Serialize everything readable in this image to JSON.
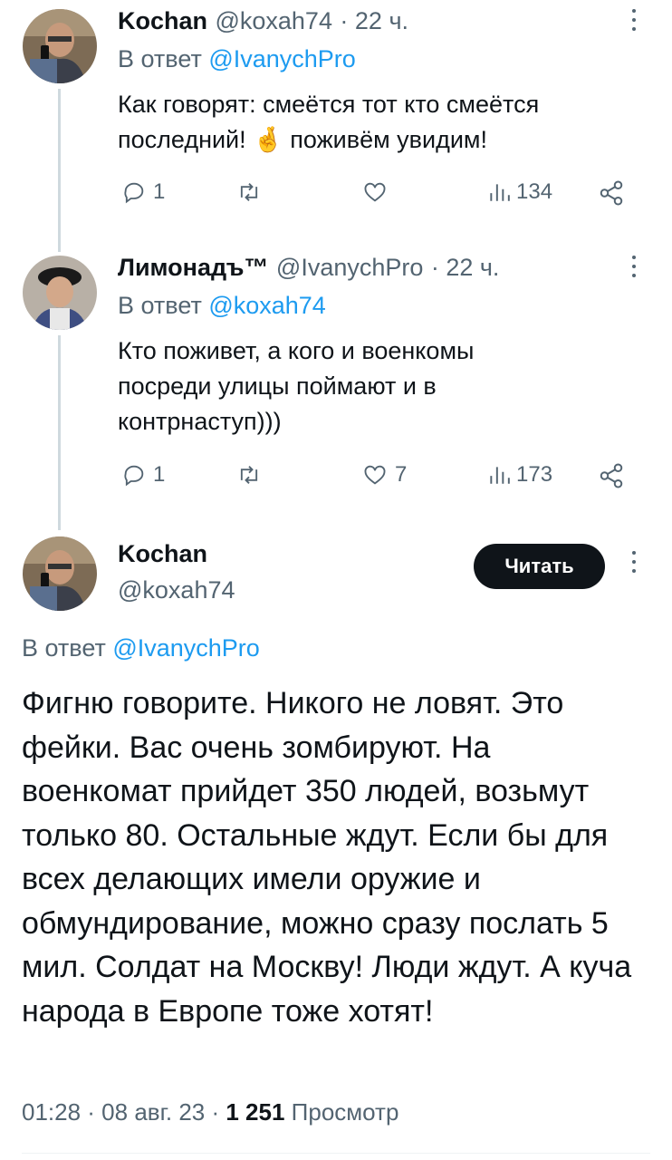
{
  "tweets": [
    {
      "name": "Kochan",
      "handle": "@koxah74",
      "time": "· 22 ч.",
      "reply_prefix": "В ответ ",
      "reply_handle": "@IvanychPro",
      "text": "Как говорят: смеётся тот кто смеётся последний! 🤞 поживём увидим!",
      "replies": "1",
      "retweets": "",
      "likes": "",
      "views": "134"
    },
    {
      "name": "Лимонадъ™",
      "handle": "@IvanychPro",
      "time": "· 22 ч.",
      "reply_prefix": "В ответ ",
      "reply_handle": "@koxah74",
      "text": "Кто поживет, а кого и военкомы посреди улицы поймают и в контрнаступ)))",
      "replies": "1",
      "retweets": "",
      "likes": "7",
      "views": "173"
    }
  ],
  "main": {
    "name": "Kochan",
    "handle": "@koxah74",
    "follow_label": "Читать",
    "reply_prefix": "В ответ ",
    "reply_handle": "@IvanychPro",
    "text": "Фигню говорите. Никого не ловят. Это фейки. Вас очень зомбируют. На военкомат прийдет 350 людей, возьмут только 80. Остальные ждут. Если бы для всех делающих имели оружие и обмундирование, можно сразу послать 5 мил. Солдат на Москву! Люди ждут. А куча народа в Европе тоже хотят!",
    "timestamp": "01:28 · 08 авг. 23 · ",
    "views_count": "1 251",
    "views_label": " Просмотр"
  },
  "colors": {
    "link": "#1d9bf0",
    "muted": "#536471",
    "text": "#0f1419",
    "button": "#0f1419"
  },
  "icons": [
    "reply-icon",
    "retweet-icon",
    "like-icon",
    "views-icon",
    "share-icon",
    "more-icon"
  ]
}
